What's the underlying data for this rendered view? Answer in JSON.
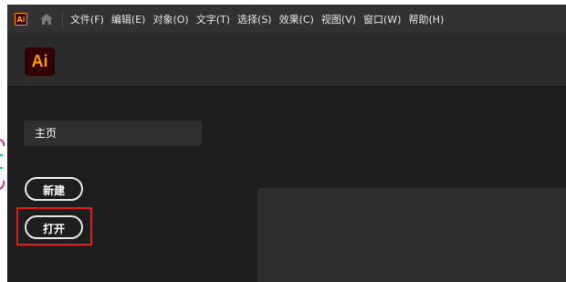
{
  "menubar": {
    "app_icon_text": "Ai",
    "items": [
      {
        "label": "文件(F)"
      },
      {
        "label": "编辑(E)"
      },
      {
        "label": "对象(O)"
      },
      {
        "label": "文字(T)"
      },
      {
        "label": "选择(S)"
      },
      {
        "label": "效果(C)"
      },
      {
        "label": "视图(V)"
      },
      {
        "label": "窗口(W)"
      },
      {
        "label": "帮助(H)"
      }
    ]
  },
  "header": {
    "logo_text": "Ai"
  },
  "sidebar": {
    "home_label": "主页",
    "new_button_label": "新建",
    "open_button_label": "打开"
  },
  "colors": {
    "brand_bg": "#330000",
    "brand_fg": "#ff9a00",
    "highlight": "#e21b1b",
    "menubar_bg": "#323232",
    "window_bg": "#1e1e1e"
  }
}
